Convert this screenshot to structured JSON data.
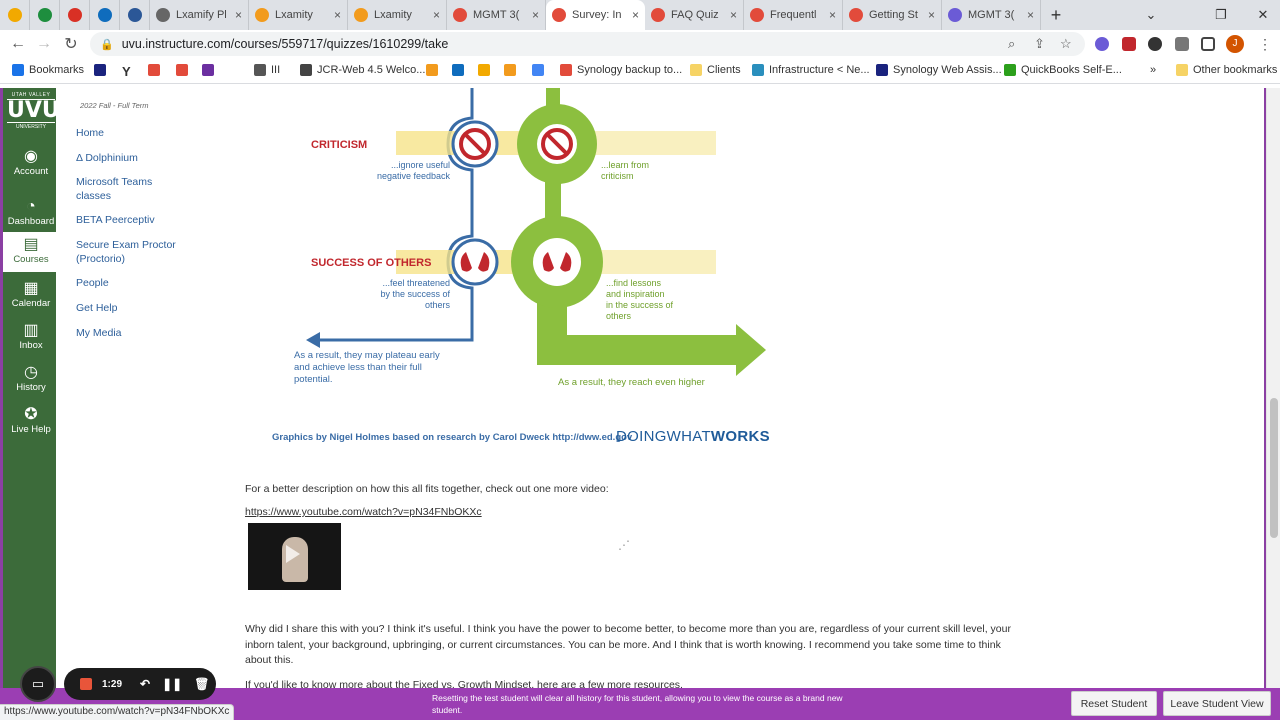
{
  "browser": {
    "tabs": [
      {
        "title": "",
        "icon": "check-icon",
        "color": "#f2a900"
      },
      {
        "title": "",
        "icon": "diamond-icon",
        "color": "#1e8e3e"
      },
      {
        "title": "",
        "icon": "gmail-icon",
        "color": "#d93025"
      },
      {
        "title": "",
        "icon": "outlook-icon",
        "color": "#0f6cbd"
      },
      {
        "title": "",
        "icon": "doc-icon",
        "color": "#2b5797"
      },
      {
        "title": "Lxamify Pl",
        "icon": "y-icon",
        "color": "#666666"
      },
      {
        "title": "Lxamity",
        "icon": "shield-icon",
        "color": "#f29b1d"
      },
      {
        "title": "Lxamity",
        "icon": "shield-icon",
        "color": "#f29b1d"
      },
      {
        "title": "MGMT 3(",
        "icon": "canvas-icon",
        "color": "#e24b3b"
      },
      {
        "title": "Survey: In",
        "icon": "canvas-icon",
        "color": "#e24b3b",
        "active": true
      },
      {
        "title": "FAQ Quiz",
        "icon": "canvas-icon",
        "color": "#e24b3b"
      },
      {
        "title": "Frequentl",
        "icon": "canvas-icon",
        "color": "#e24b3b"
      },
      {
        "title": "Getting St",
        "icon": "canvas-icon",
        "color": "#e24b3b"
      },
      {
        "title": "MGMT 3(",
        "icon": "gear-purple-icon",
        "color": "#6b5bd6"
      }
    ],
    "new_tab": "+",
    "url": "uvu.instructure.com/courses/559717/quizzes/1610299/take",
    "bookmarks": [
      {
        "label": "Bookmarks",
        "color": "#1a73e8"
      },
      {
        "label": "",
        "color": "#1a237e"
      },
      {
        "label": "Y",
        "color": "#ffffff"
      },
      {
        "label": "",
        "color": "#e24b3b"
      },
      {
        "label": "",
        "color": "#e24b3b"
      },
      {
        "label": "",
        "color": "#6b2fa0"
      },
      {
        "label": "III",
        "color": "#555555"
      },
      {
        "label": "JCR-Web 4.5 Welco...",
        "color": "#444444"
      },
      {
        "label": "",
        "color": "#f29b1d"
      },
      {
        "label": "",
        "color": "#0f6cbd"
      },
      {
        "label": "",
        "color": "#f2a900"
      },
      {
        "label": "",
        "color": "#f29b1d"
      },
      {
        "label": "",
        "color": "#4285f4"
      },
      {
        "label": "Synology backup to...",
        "color": "#e24b3b"
      },
      {
        "label": "Clients",
        "color": "#f6d365"
      },
      {
        "label": "Infrastructure < Ne...",
        "color": "#2a8fbd"
      },
      {
        "label": "Synology Web Assis...",
        "color": "#1a237e"
      },
      {
        "label": "QuickBooks Self-E...",
        "color": "#2ca01c"
      },
      {
        "label": "»",
        "color": ""
      },
      {
        "label": "Other bookmarks",
        "color": "#f6d365"
      }
    ]
  },
  "global_nav": {
    "logo_top": "UTAH VALLEY",
    "logo_main": "UVU",
    "logo_bottom": "UNIVERSITY",
    "items": [
      {
        "label": "Account",
        "icon": "account-icon"
      },
      {
        "label": "Dashboard",
        "icon": "dashboard-icon"
      },
      {
        "label": "Courses",
        "icon": "courses-icon",
        "active": true
      },
      {
        "label": "Calendar",
        "icon": "calendar-icon"
      },
      {
        "label": "Inbox",
        "icon": "inbox-icon"
      },
      {
        "label": "History",
        "icon": "history-icon"
      },
      {
        "label": "Live Help",
        "icon": "help-icon"
      }
    ]
  },
  "course_nav": {
    "term": "2022 Fall - Full Term",
    "links": [
      "Home",
      "Δ Dolphinium",
      "Microsoft Teams classes",
      "BETA Peerceptiv",
      "Secure Exam Proctor (Proctorio)",
      "People",
      "Get Help",
      "My Media"
    ]
  },
  "infographic": {
    "criticism_title": "CRITICISM",
    "criticism_left": [
      "...ignore useful",
      "negative feedback"
    ],
    "criticism_right": [
      "...learn from",
      "criticism"
    ],
    "success_title": "SUCCESS OF OTHERS",
    "success_left": [
      "...feel threatened",
      "by the success of",
      "others"
    ],
    "success_right": [
      "...find lessons",
      "and inspiration",
      "in the success of",
      "others"
    ],
    "result_left": [
      "As a result, they may plateau early",
      "and achieve less than their full",
      "potential."
    ],
    "result_right": "As a result, they reach even higher",
    "credit": "Graphics by Nigel Holmes based on research by Carol Dweck     http://dww.ed.gov",
    "brand_a": "DOINGWHAT",
    "brand_b": "WORKS",
    "colors": {
      "blue": "#3a6ca6",
      "green": "#8cbf3f",
      "red": "#c1272d",
      "yellow": "#f6e48a"
    }
  },
  "content": {
    "intro": "For a better description on how this all fits together, check out one more video:",
    "link": "https://www.youtube.com/watch?v=pN34FNbOKXc",
    "para": "Why did I share this with you? I think it's useful. I think you have the power to become better, to become more than you are, regardless of your current skill level, your inborn talent, your background, upbringing, or current circumstances. You can be more. And I think that is worth knowing. I recommend you take some time to think about this.",
    "para2": "If you'd like to know more about the Fixed vs. Growth Mindset, here are a few more resources."
  },
  "student_view": {
    "message": "Resetting the test student will clear all history for this student, allowing you to view the course as a brand new student.",
    "reset_label": "Reset Student",
    "leave_label": "Leave Student View"
  },
  "status_bar": "https://www.youtube.com/watch?v=pN34FNbOKXc",
  "recorder": {
    "time": "1:29"
  }
}
